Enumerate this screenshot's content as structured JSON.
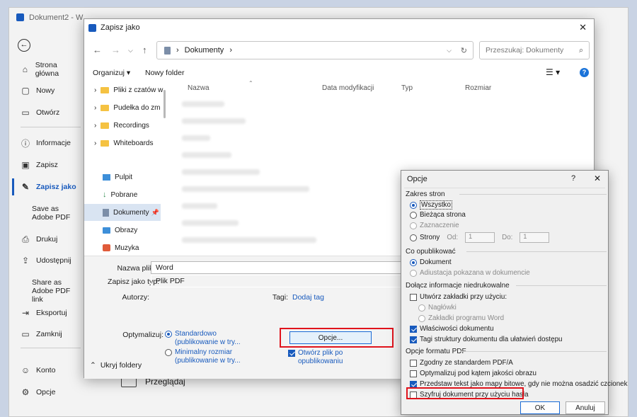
{
  "word": {
    "title": "Dokument2 - W",
    "back_icon": "back-arrow-icon",
    "nav": [
      {
        "label": "Strona główna",
        "icon": "home-icon"
      },
      {
        "label": "Nowy",
        "icon": "new-doc-icon"
      },
      {
        "label": "Otwórz",
        "icon": "folder-open-icon"
      },
      {
        "label": "Informacje",
        "icon": "info-icon"
      },
      {
        "label": "Zapisz",
        "icon": "save-icon"
      },
      {
        "label": "Zapisz jako",
        "icon": "save-as-icon"
      },
      {
        "label": "Save as Adobe PDF",
        "icon": ""
      },
      {
        "label": "Drukuj",
        "icon": "print-icon"
      },
      {
        "label": "Udostępnij",
        "icon": "share-icon"
      },
      {
        "label": "Share as Adobe PDF link",
        "icon": ""
      },
      {
        "label": "Eksportuj",
        "icon": "export-icon"
      },
      {
        "label": "Zamknij",
        "icon": "close-doc-icon"
      },
      {
        "label": "Konto",
        "icon": "account-icon"
      },
      {
        "label": "Opcje",
        "icon": "options-icon"
      }
    ],
    "browse_label": "Przeglądaj"
  },
  "saveas": {
    "title": "Zapisz jako",
    "address": "Dokumenty",
    "search_placeholder": "Przeszukaj: Dokumenty",
    "organize": "Organizuj",
    "new_folder": "Nowy folder",
    "tree": [
      "Pliki z czatów w",
      "Pudełka do zm",
      "Recordings",
      "Whiteboards",
      "Pulpit",
      "Pobrane",
      "Dokumenty",
      "Obrazy",
      "Muzyka"
    ],
    "columns": [
      "Nazwa",
      "Data modyfikacji",
      "Typ",
      "Rozmiar"
    ],
    "filename_label": "Nazwa pliku:",
    "filename": "Word",
    "savetype_label": "Zapisz jako typ:",
    "savetype": "Plik PDF",
    "authors_label": "Autorzy:",
    "tags_label": "Tagi:",
    "add_tag": "Dodaj tag",
    "optimize_label": "Optymalizuj:",
    "opt_standard": "Standardowo (publikowanie w try...",
    "opt_minimal": "Minimalny rozmiar (publikowanie w try...",
    "options_button": "Opcje...",
    "open_after": "Otwórz plik po opublikowaniu",
    "hide_folders": "Ukryj foldery"
  },
  "opcje": {
    "title": "Opcje",
    "help": "?",
    "range_section": "Zakres stron",
    "range_all": "Wszystko",
    "range_current": "Bieżąca strona",
    "range_selection": "Zaznaczenie",
    "range_pages": "Strony",
    "from_label": "Od:",
    "from_value": "1",
    "to_label": "Do:",
    "to_value": "1",
    "publish_section": "Co opublikować",
    "publish_doc": "Dokument",
    "publish_markup": "Adiustacja pokazana w dokumencie",
    "nonprint_section": "Dołącz informacje niedrukowalne",
    "bookmarks": "Utwórz zakładki przy użyciu:",
    "headings": "Nagłówki",
    "word_bookmarks": "Zakładki programu Word",
    "doc_props": "Właściwości dokumentu",
    "struct_tags": "Tagi struktury dokumentu dla ułatwień dostępu",
    "pdf_section": "Opcje formatu PDF",
    "pdfa": "Zgodny ze standardem PDF/A",
    "optimize_image": "Optymalizuj pod kątem jakości obrazu",
    "bitmap_text": "Przedstaw tekst jako mapy bitowe, gdy nie można osadzić czcionek",
    "encrypt": "Szyfruj dokument przy użyciu hasła",
    "ok": "OK",
    "cancel": "Anuluj"
  }
}
